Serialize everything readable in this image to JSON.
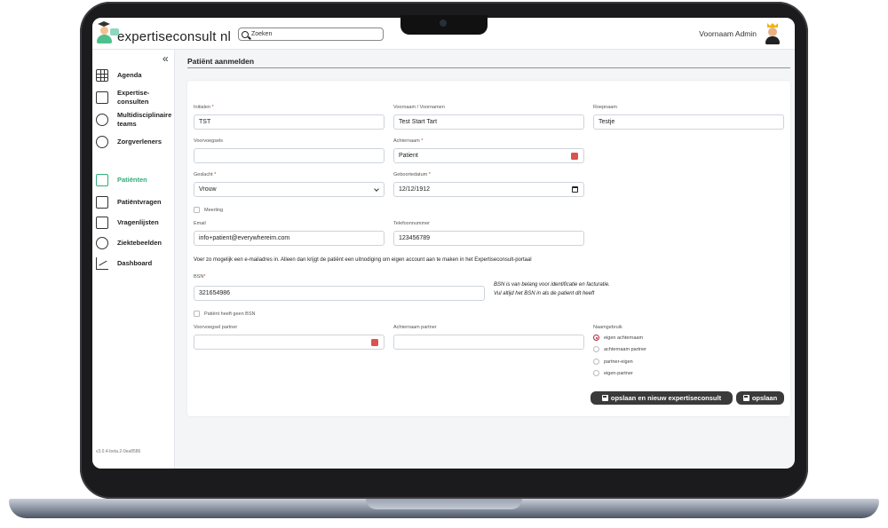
{
  "header": {
    "logo_text": "expertiseconsult nl",
    "search_placeholder": "Zoeken",
    "user_name": "Voornaam Admin"
  },
  "sidebar": {
    "collapse_glyph": "«",
    "items": [
      {
        "label": "Agenda",
        "icon": "calendar-icon"
      },
      {
        "label": "Expertise-consulten",
        "icon": "medical-kit-icon"
      },
      {
        "label": "Multidisciplinaire teams",
        "icon": "team-icon"
      },
      {
        "label": "Zorgverleners",
        "icon": "doctor-icon"
      },
      {
        "label": "Patiënten",
        "icon": "patient-icon",
        "active": true
      },
      {
        "label": "Patiëntvragen",
        "icon": "chat-icon"
      },
      {
        "label": "Vragenlijsten",
        "icon": "form-edit-icon"
      },
      {
        "label": "Ziektebeelden",
        "icon": "network-icon"
      },
      {
        "label": "Dashboard",
        "icon": "line-chart-icon"
      }
    ],
    "version": "v3.0.4-beta.2-0ea8586"
  },
  "main": {
    "title": "Patiënt aanmelden",
    "form": {
      "initialen": {
        "label": "Initialen",
        "value": "TST"
      },
      "voornaam": {
        "label": "Voornaam / Voornamen",
        "value": "Test Start Tart"
      },
      "roepnaam": {
        "label": "Roepnaam",
        "value": "Testje"
      },
      "voorvoegsels": {
        "label": "Voorvoegsels",
        "value": ""
      },
      "achternaam": {
        "label": "Achternaam",
        "value": "Patient"
      },
      "geslacht": {
        "label": "Geslacht",
        "value": "Vrouw"
      },
      "geboortedatum": {
        "label": "Geboortedatum",
        "value": "12/12/1912"
      },
      "meerling": {
        "label": "Meerling"
      },
      "email": {
        "label": "Email",
        "value": "info+patient@everywhereim.com"
      },
      "telefoon": {
        "label": "Telefoonnummer",
        "value": "123456789"
      },
      "email_info": "Voer zo mogelijk een e-mailadres in. Alleen dan krijgt de patiënt een uitnodiging om eigen account aan te maken in het Expertiseconsult-portaal",
      "bsn": {
        "label": "BSN",
        "value": "321654986"
      },
      "bsn_hint_1": "BSN is van belang voor identificatie en facturatie.",
      "bsn_hint_2": "Vul altijd het BSN in als de patient dit heeft",
      "geen_bsn": {
        "label": "Patiënt heeft geen BSN"
      },
      "voorvoegsel_partner": {
        "label": "Voorvoegsel partner",
        "value": ""
      },
      "achternaam_partner": {
        "label": "Achternaam partner",
        "value": ""
      },
      "naamgebruik": {
        "label": "Naamgebruik",
        "options": [
          "eigen achternaam",
          "achternaam partner",
          "partner-eigen",
          "eigen-partner"
        ],
        "selected": "eigen achternaam"
      }
    },
    "buttons": {
      "save_new": "opslaan en nieuw expertiseconsult",
      "save": "opslaan"
    }
  },
  "colors": {
    "accent_green": "#2fae7b",
    "button_dark": "#3a3a3a",
    "radio_selected": "#b22234"
  }
}
